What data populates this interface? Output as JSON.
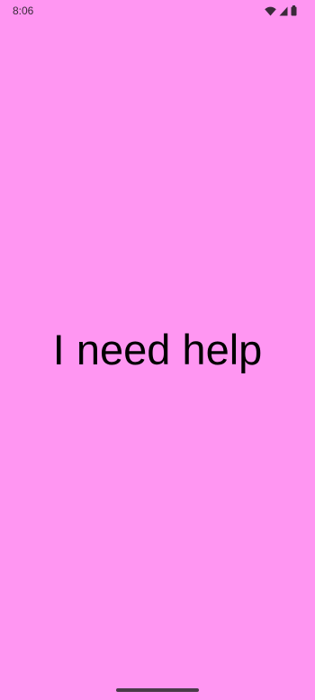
{
  "theme": {
    "background": "#ff96f2",
    "indicator": "#4a3a4a"
  },
  "status_bar": {
    "time": "8:06",
    "icons": [
      "wifi-icon",
      "cell-signal-icon",
      "battery-icon"
    ]
  },
  "main": {
    "message": "I need help"
  }
}
